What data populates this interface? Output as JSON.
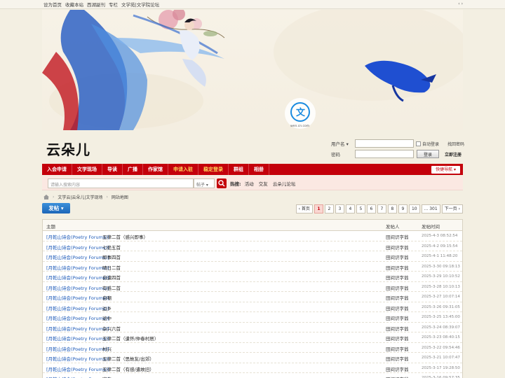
{
  "topbar": {
    "links": [
      "设为首页",
      "收藏本站",
      "西湖副刊",
      "专栏",
      "文学苑|文学院论坛"
    ],
    "arrows": "‹ ›"
  },
  "banner": {
    "watermark": "wen.cn.com"
  },
  "logo": {
    "text": "云朵儿"
  },
  "login": {
    "username_label": "用户名",
    "password_label": "密码",
    "remember_label": "自动登录",
    "forgot_label": "找回密码",
    "login_button": "登录",
    "register_label": "立即注册"
  },
  "nav": {
    "items": [
      {
        "label": "入会申请",
        "highlight": false
      },
      {
        "label": "文学现场",
        "highlight": false
      },
      {
        "label": "导读",
        "highlight": false
      },
      {
        "label": "广播",
        "highlight": false
      },
      {
        "label": "作家馆",
        "highlight": false
      },
      {
        "label": "申请入驻",
        "highlight": true
      },
      {
        "label": "稳定登录",
        "highlight": true
      },
      {
        "label": "群组",
        "highlight": false
      },
      {
        "label": "相册",
        "highlight": false
      }
    ],
    "quick_nav": "快捷导航"
  },
  "search": {
    "placeholder": "请输入搜索内容",
    "type_select": "帖子",
    "hot_label": "热搜:",
    "hot_items": [
      "活动",
      "交友",
      "云朵儿论坛"
    ]
  },
  "breadcrumb": {
    "items": [
      "文学云|云朵儿|文学现场",
      "网站地图"
    ]
  },
  "post_button": "发帖",
  "pager": {
    "prev": "首页",
    "pages": [
      "1",
      "2",
      "3",
      "4",
      "5",
      "6",
      "7",
      "8",
      "9",
      "10"
    ],
    "last": "... 301",
    "next": "下一页",
    "current": "1"
  },
  "threads": {
    "headers": {
      "subject": "主题",
      "author": "发帖人",
      "time": "发帖时间"
    },
    "rows": [
      {
        "forum": "[月乾山诗会(Poetry Forums)]",
        "title": "五律二首（感兴即事）",
        "author": "田间识字翁",
        "date": "2025-4-3 08:52:54"
      },
      {
        "forum": "[月乾山诗会(Poetry Forums)]",
        "title": "七绝五首",
        "author": "田间识字翁",
        "date": "2025-4-2 09:15:54"
      },
      {
        "forum": "[月乾山诗会(Poetry Forums)]",
        "title": "即事四首",
        "author": "田间识字翁",
        "date": "2025-4-1 11:48:20"
      },
      {
        "forum": "[月乾山诗会(Poetry Forums)]",
        "title": "晴日二首",
        "author": "田间识字翁",
        "date": "2025-3-30 09:18:13"
      },
      {
        "forum": "[月乾山诗会(Poetry Forums)]",
        "title": "自遣四首",
        "author": "田间识字翁",
        "date": "2025-3-29 10:10:52"
      },
      {
        "forum": "[月乾山诗会(Poetry Forums)]",
        "title": "有感二首",
        "author": "田间识字翁",
        "date": "2025-3-28 10:10:13"
      },
      {
        "forum": "[月乾山诗会(Poetry Forums)]",
        "title": "自嘲",
        "author": "田间识字翁",
        "date": "2025-3-27 10:07:14"
      },
      {
        "forum": "[月乾山诗会(Poetry Forums)]",
        "title": "边乡",
        "author": "田间识字翁",
        "date": "2025-3-26 09:31:05"
      },
      {
        "forum": "[月乾山诗会(Poetry Forums)]",
        "title": "途中",
        "author": "田间识字翁",
        "date": "2025-3-25 13:45:00"
      },
      {
        "forum": "[月乾山诗会(Poetry Forums)]",
        "title": "杂兴六首",
        "author": "田间识字翁",
        "date": "2025-3-24 08:39:07"
      },
      {
        "forum": "[月乾山诗会(Poetry Forums)]",
        "title": "五律二首（遣怀/仲春村居）",
        "author": "田间识字翁",
        "date": "2025-3-23 08:40:15"
      },
      {
        "forum": "[月乾山诗会(Poetry Forums)]",
        "title": "村兴",
        "author": "田间识字翁",
        "date": "2025-3-22 09:54:46"
      },
      {
        "forum": "[月乾山诗会(Poetry Forums)]",
        "title": "五律二首（思故友/出郊）",
        "author": "田间识字翁",
        "date": "2025-3-21 10:07:47"
      },
      {
        "forum": "[月乾山诗会(Poetry Forums)]",
        "title": "五律二首（有感/遣故旧）",
        "author": "田间识字翁",
        "date": "2025-3-17 19:28:50"
      },
      {
        "forum": "[月乾山诗会(Poetry Forums)]",
        "title": "寄表",
        "author": "田间识字翁",
        "date": "2025-3-16 09:57:35"
      }
    ]
  },
  "colors": {
    "nav_red": "#c4000b",
    "link_blue": "#1d5ab8",
    "post_blue": "#1d66b8"
  }
}
